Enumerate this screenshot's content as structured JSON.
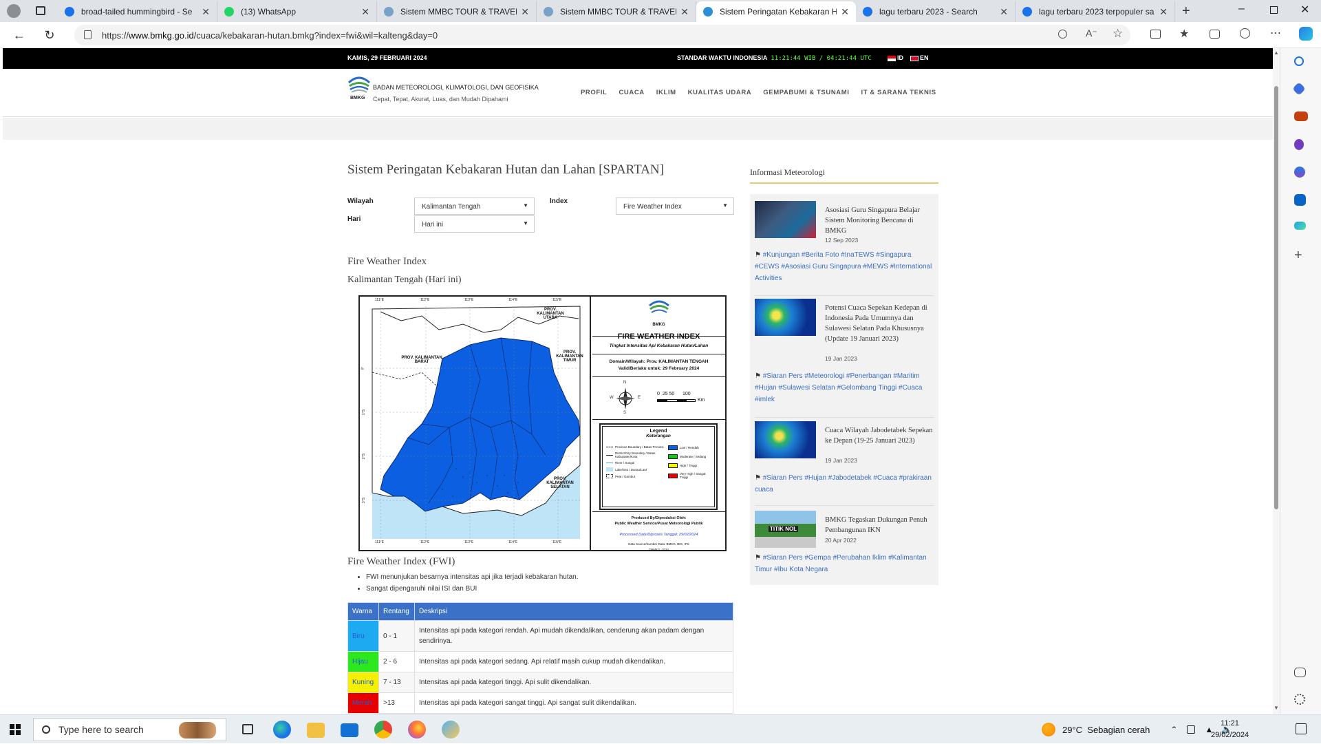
{
  "browser": {
    "tabs": [
      {
        "label": "broad-tailed hummingbird - Se",
        "icon_color": "#1a73e8"
      },
      {
        "label": "(13) WhatsApp",
        "icon_color": "#25d366"
      },
      {
        "label": "Sistem MMBC TOUR & TRAVEL",
        "icon_color": "#7aa2c8"
      },
      {
        "label": "Sistem MMBC TOUR & TRAVEL",
        "icon_color": "#7aa2c8"
      },
      {
        "label": "Sistem Peringatan Kebakaran H",
        "icon_color": "#2d8fd5"
      },
      {
        "label": "lagu terbaru 2023 - Search",
        "icon_color": "#1a73e8"
      },
      {
        "label": "lagu terbaru 2023 terpopuler sa",
        "icon_color": "#1a73e8"
      }
    ],
    "url_prefix": "https://",
    "url_host": "www.bmkg.go.id",
    "url_path": "/cuaca/kebakaran-hutan.bmkg?index=fwi&wil=kalteng&day=0"
  },
  "topbar": {
    "date": "KAMIS, 29 FEBRUARI 2024",
    "std_label": "STANDAR WAKTU INDONESIA",
    "wib": "11:21:44 WIB",
    "utc": "04:21:44 UTC",
    "lang_id": "ID",
    "lang_en": "EN"
  },
  "header": {
    "logo_text": "BMKG",
    "org_name": "BADAN METEOROLOGI, KLIMATOLOGI, DAN GEOFISIKA",
    "tagline": "Cepat, Tepat, Akurat, Luas, dan Mudah Dipahami",
    "menu": [
      "PROFIL",
      "CUACA",
      "IKLIM",
      "KUALITAS UDARA",
      "GEMPABUMI & TSUNAMI",
      "IT & SARANA TEKNIS"
    ]
  },
  "main": {
    "title": "Sistem Peringatan Kebakaran Hutan dan Lahan [SPARTAN]",
    "filters": {
      "wilayah_label": "Wilayah",
      "wilayah_value": "Kalimantan Tengah",
      "hari_label": "Hari",
      "hari_value": "Hari ini",
      "index_label": "Index",
      "index_value": "Fire Weather Index"
    },
    "section_title": "Fire Weather Index",
    "section_subtitle": "Kalimantan Tengah (Hari ini)",
    "map": {
      "panel_logo": "BMKG",
      "panel_title": "FIRE WEATHER INDEX",
      "panel_subtitle": "Tingkat Intensitas Api Kebakaran Hutan/Lahan",
      "domain_line": "Domain/Wilayah: Prov. KALIMANTAN TENGAH",
      "valid_line": "Valid/Berlaku untuk: 29 February 2024",
      "scale_label": "0  25 50      100",
      "scale_unit": "Km",
      "compass_n": "N",
      "compass_s": "S",
      "compass_e": "E",
      "compass_w": "W",
      "legend_title": "Legend",
      "legend_subtitle": "Keterangan",
      "legend_lines": [
        "Province Boundary / Batas Provinsi",
        "District/City Boundary / Batas Kabupaten/Kota",
        "River / Sungai",
        "Lake/Sea / Danau/Laut",
        "Peat / Gambut"
      ],
      "legend_colors": [
        {
          "label": "Low / Rendah",
          "color": "#0b5fe0"
        },
        {
          "label": "Moderate / Sedang",
          "color": "#19c419"
        },
        {
          "label": "High / Tinggi",
          "color": "#f5f500"
        },
        {
          "label": "Very High / Sangat Tinggi",
          "color": "#e80000"
        }
      ],
      "produced_line1": "Produced By/Diproduksi Oleh:",
      "produced_line2": "Public Weather Service/Pusat Meteorologi Publik",
      "processed": "Processed Date/Diproses Tanggal: 29/02/2024",
      "source": "Data Source/Sumber Data: BMKG, BIG, IPS",
      "copyright": "©BMKG, 2024",
      "lon_ticks": [
        "111°E",
        "112°E",
        "113°E",
        "114°E",
        "115°E"
      ],
      "lat_ticks": [
        "0°",
        "1°S",
        "2°S",
        "3°S"
      ],
      "labels": {
        "kalbar": "PROV. KALIMANTAN BARAT",
        "kaltim": "PROV. KALIMANTAN TIMUR",
        "kalsel": "PROV. KALIMANTAN SELATAN",
        "kalut": "PROV. KALIMANTAN UTARA"
      }
    },
    "fwi_heading": "Fire Weather Index (FWI)",
    "bullets": [
      "FWI menunjukan besarnya intensitas api jika terjadi kebakaran hutan.",
      "Sangat dipengaruhi nilai ISI dan BUI"
    ],
    "table": {
      "headers": [
        "Warna",
        "Rentang",
        "Deskripsi"
      ],
      "rows": [
        {
          "warna": "Biru",
          "color": "#1eaaf0",
          "rentang": "0 - 1",
          "deskripsi": "Intensitas api pada kategori rendah. Api mudah dikendalikan, cenderung akan padam dengan sendirinya."
        },
        {
          "warna": "Hijau",
          "color": "#2ee81e",
          "rentang": "2 - 6",
          "deskripsi": "Intensitas api pada kategori sedang. Api relatif masih cukup mudah dikendalikan."
        },
        {
          "warna": "Kuning",
          "color": "#f5f000",
          "rentang": "7 - 13",
          "deskripsi": "Intensitas api pada kategori tinggi. Api sulit dikendalikan."
        },
        {
          "warna": "Merah",
          "color": "#e60000",
          "rentang": ">13",
          "deskripsi": "Intensitas api pada kategori sangat tinggi. Api sangat sulit dikendalikan."
        }
      ]
    }
  },
  "sidebar": {
    "heading": "Informasi Meteorologi",
    "news": [
      {
        "title": "Asosiasi Guru Singapura Belajar Sistem Monitoring Bencana di BMKG",
        "date": "12 Sep 2023",
        "tags": "#Kunjungan #Berita Foto #InaTEWS #Singapura #CEWS #Asosiasi Guru Singapura #MEWS #International Activities"
      },
      {
        "title": "Potensi Cuaca Sepekan Kedepan di Indonesia Pada Umumnya dan Sulawesi Selatan Pada Khususnya (Update 19 Januari 2023)",
        "date": "19 Jan 2023",
        "tags": "#Siaran Pers #Meteorologi #Penerbangan #Maritim #Hujan #Sulawesi Selatan #Gelombang Tinggi #Cuaca #imlek"
      },
      {
        "title": "Cuaca Wilayah Jabodetabek Sepekan ke Depan (19-25 Januari 2023)",
        "date": "19 Jan 2023",
        "tags": "#Siaran Pers #Hujan #Jabodetabek #Cuaca #prakiraan cuaca"
      },
      {
        "title": "BMKG Tegaskan Dukungan Penuh Pembangunan IKN",
        "date": "20 Apr 2022",
        "tags": "#Siaran Pers #Gempa #Perubahan Iklim #Kalimantan Timur #Ibu Kota Negara",
        "thumb_text": "TITIK NOL"
      }
    ]
  },
  "taskbar": {
    "search_placeholder": "Type here to search",
    "weather": "29°C  Sebagian cerah",
    "time": "11:21",
    "date": "29/02/2024"
  },
  "colors": {
    "map_blue": "#0b5fe0",
    "sea": "#bfe3f7",
    "table_header": "#3b72c8",
    "link": "#3b6fc2"
  }
}
